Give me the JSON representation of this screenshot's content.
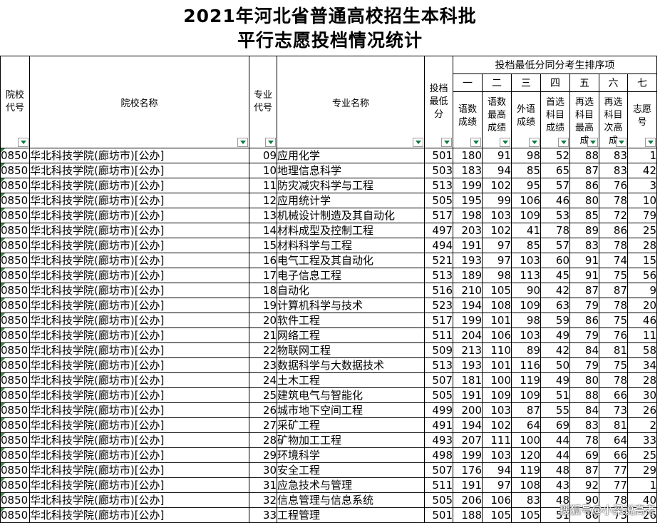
{
  "title": {
    "line1": "2021年河北省普通高校招生本科批",
    "line2": "平行志愿投档情况统计"
  },
  "headers": {
    "college_code": [
      "院校",
      "代号"
    ],
    "college_name": "院校名称",
    "major_code": [
      "专业",
      "代号"
    ],
    "major_name": "专业名称",
    "min_score": [
      "投档",
      "最低",
      "分"
    ],
    "group": "投档最低分同分考生排序项",
    "ranks": [
      "一",
      "二",
      "三",
      "四",
      "五",
      "六",
      "七"
    ],
    "sub": [
      [
        "语数",
        "成绩"
      ],
      [
        "语数",
        "最高",
        "成绩"
      ],
      [
        "外语",
        "成绩"
      ],
      [
        "首选",
        "科目",
        "成绩"
      ],
      [
        "再选",
        "科目",
        "最高",
        "成"
      ],
      [
        "再选",
        "科目",
        "次高",
        "成"
      ],
      [
        "志愿",
        "号"
      ]
    ]
  },
  "colors": {
    "filter_arrow": "#0a7a3a",
    "cell_marker": "#2e8b3a",
    "border": "#000000"
  },
  "rows": [
    [
      "0850",
      "华北科技学院(廊坊市)[公办]",
      "09",
      "应用化学",
      "501",
      "180",
      "91",
      "98",
      "52",
      "88",
      "83",
      "1"
    ],
    [
      "0850",
      "华北科技学院(廊坊市)[公办]",
      "10",
      "地理信息科学",
      "503",
      "183",
      "94",
      "85",
      "65",
      "87",
      "83",
      "42"
    ],
    [
      "0850",
      "华北科技学院(廊坊市)[公办]",
      "11",
      "防灾减灾科学与工程",
      "513",
      "199",
      "102",
      "95",
      "57",
      "86",
      "76",
      "3"
    ],
    [
      "0850",
      "华北科技学院(廊坊市)[公办]",
      "12",
      "应用统计学",
      "505",
      "195",
      "99",
      "106",
      "46",
      "80",
      "78",
      "10"
    ],
    [
      "0850",
      "华北科技学院(廊坊市)[公办]",
      "13",
      "机械设计制造及其自动化",
      "517",
      "198",
      "103",
      "109",
      "53",
      "85",
      "72",
      "79"
    ],
    [
      "0850",
      "华北科技学院(廊坊市)[公办]",
      "14",
      "材料成型及控制工程",
      "497",
      "203",
      "102",
      "41",
      "78",
      "89",
      "86",
      "25"
    ],
    [
      "0850",
      "华北科技学院(廊坊市)[公办]",
      "15",
      "材料科学与工程",
      "494",
      "191",
      "97",
      "85",
      "57",
      "83",
      "78",
      "28"
    ],
    [
      "0850",
      "华北科技学院(廊坊市)[公办]",
      "16",
      "电气工程及其自动化",
      "521",
      "193",
      "97",
      "103",
      "60",
      "91",
      "74",
      "15"
    ],
    [
      "0850",
      "华北科技学院(廊坊市)[公办]",
      "17",
      "电子信息工程",
      "513",
      "189",
      "98",
      "113",
      "45",
      "91",
      "75",
      "56"
    ],
    [
      "0850",
      "华北科技学院(廊坊市)[公办]",
      "18",
      "自动化",
      "516",
      "210",
      "105",
      "90",
      "42",
      "87",
      "87",
      "9"
    ],
    [
      "0850",
      "华北科技学院(廊坊市)[公办]",
      "19",
      "计算机科学与技术",
      "523",
      "194",
      "108",
      "109",
      "63",
      "79",
      "78",
      "20"
    ],
    [
      "0850",
      "华北科技学院(廊坊市)[公办]",
      "20",
      "软件工程",
      "517",
      "199",
      "101",
      "98",
      "59",
      "86",
      "75",
      "46"
    ],
    [
      "0850",
      "华北科技学院(廊坊市)[公办]",
      "21",
      "网络工程",
      "511",
      "204",
      "106",
      "103",
      "49",
      "79",
      "76",
      "11"
    ],
    [
      "0850",
      "华北科技学院(廊坊市)[公办]",
      "22",
      "物联网工程",
      "509",
      "213",
      "110",
      "89",
      "42",
      "84",
      "81",
      "58"
    ],
    [
      "0850",
      "华北科技学院(廊坊市)[公办]",
      "23",
      "数据科学与大数据技术",
      "513",
      "193",
      "101",
      "116",
      "50",
      "79",
      "75",
      "34"
    ],
    [
      "0850",
      "华北科技学院(廊坊市)[公办]",
      "24",
      "土木工程",
      "507",
      "181",
      "100",
      "119",
      "49",
      "80",
      "78",
      "28"
    ],
    [
      "0850",
      "华北科技学院(廊坊市)[公办]",
      "25",
      "建筑电气与智能化",
      "505",
      "191",
      "109",
      "109",
      "51",
      "88",
      "66",
      "30"
    ],
    [
      "0850",
      "华北科技学院(廊坊市)[公办]",
      "26",
      "城市地下空间工程",
      "499",
      "200",
      "103",
      "87",
      "55",
      "84",
      "73",
      "26"
    ],
    [
      "0850",
      "华北科技学院(廊坊市)[公办]",
      "27",
      "采矿工程",
      "491",
      "194",
      "102",
      "64",
      "69",
      "83",
      "81",
      "2"
    ],
    [
      "0850",
      "华北科技学院(廊坊市)[公办]",
      "28",
      "矿物加工工程",
      "493",
      "207",
      "111",
      "100",
      "44",
      "78",
      "64",
      "33"
    ],
    [
      "0850",
      "华北科技学院(廊坊市)[公办]",
      "29",
      "环境科学",
      "498",
      "199",
      "103",
      "120",
      "44",
      "69",
      "66",
      "25"
    ],
    [
      "0850",
      "华北科技学院(廊坊市)[公办]",
      "30",
      "安全工程",
      "507",
      "176",
      "94",
      "119",
      "48",
      "87",
      "77",
      "29"
    ],
    [
      "0850",
      "华北科技学院(廊坊市)[公办]",
      "31",
      "应急技术与管理",
      "511",
      "191",
      "97",
      "108",
      "43",
      "92",
      "77",
      "1"
    ],
    [
      "0850",
      "华北科技学院(廊坊市)[公办]",
      "32",
      "信息管理与信息系统",
      "505",
      "206",
      "106",
      "83",
      "48",
      "90",
      "78",
      "40"
    ],
    [
      "0850",
      "华北科技学院(廊坊市)[公办]",
      "33",
      "工程管理",
      "501",
      "188",
      "105",
      "105",
      "51",
      "86",
      "73",
      "26"
    ]
  ],
  "watermark": "搜狐号@小梁说高考"
}
